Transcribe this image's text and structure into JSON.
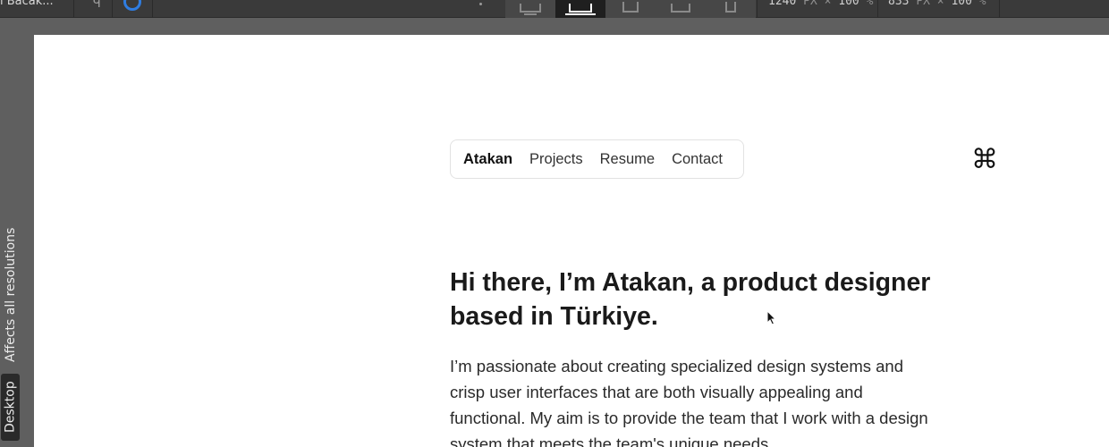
{
  "toolbar": {
    "crumb": "l Bacak...",
    "breakpoints": [
      {
        "name": "desktop-large",
        "active": false
      },
      {
        "name": "laptop",
        "active": true
      },
      {
        "name": "tablet-landscape",
        "active": false
      },
      {
        "name": "tablet-portrait",
        "active": false
      },
      {
        "name": "phone",
        "active": false
      }
    ],
    "width_value": "1240",
    "width_unit": "PX",
    "zoom_value": "100",
    "zoom_unit": "%",
    "preview_width": "833",
    "preview_unit": "PX",
    "preview_zoom": "100",
    "preview_zoom_unit": "%"
  },
  "rail": {
    "desktop_label": "Desktop",
    "affects_label": "Affects all resolutions"
  },
  "site": {
    "nav": [
      "Atakan",
      "Projects",
      "Resume",
      "Contact"
    ],
    "cmd_icon": "⌘",
    "headline": "Hi there, I’m Atakan, a product designer based in Türkiye.",
    "intro": "I’m passionate about creating specialized design systems and crisp user interfaces that are both visually appealing and functional. My aim is to provide the team that I work with a design system that meets the team's unique needs."
  }
}
